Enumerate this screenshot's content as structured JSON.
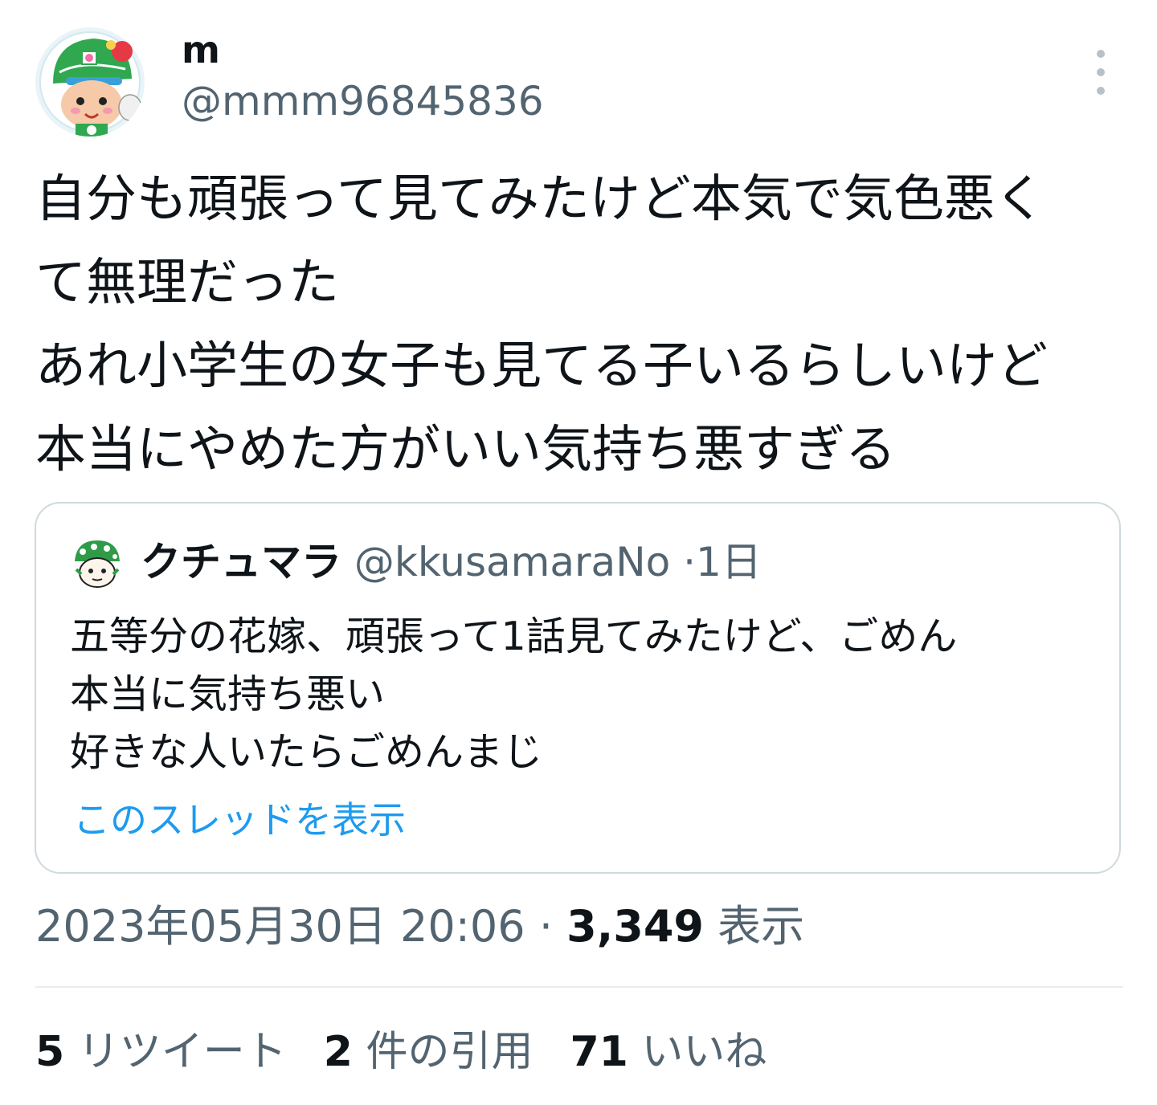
{
  "author": {
    "display_name": "m",
    "handle": "@mmm96845836",
    "avatar_icon": "mascot-avatar-icon"
  },
  "more_icon": "more-vertical-icon",
  "tweet": {
    "text": "自分も頑張って見てみたけど本気で気色悪く\nて無理だった\nあれ小学生の女子も見てる子いるらしいけど\n本当にやめた方がいい気持ち悪すぎる"
  },
  "quote": {
    "avatar_icon": "quote-avatar-icon",
    "display_name": "クチュマラ",
    "handle": "@kkusamaraNo",
    "separator": "·",
    "time": "1日",
    "text": "五等分の花嫁、頑張って1話見てみたけど、ごめん\n本当に気持ち悪い\n好きな人いたらごめんまじ",
    "thread_link": "このスレッドを表示"
  },
  "meta": {
    "timestamp": "2023年05月30日 20:06",
    "separator": "·",
    "views_count": "3,349",
    "views_label": "表示"
  },
  "stats": {
    "retweets_count": "5",
    "retweets_label": "リツイート",
    "quotes_count": "2",
    "quotes_label": "件の引用",
    "likes_count": "71",
    "likes_label": "いいね"
  },
  "colors": {
    "text": "#0f1419",
    "secondary": "#536471",
    "link": "#1d9bf0",
    "border": "#cfd9de"
  }
}
